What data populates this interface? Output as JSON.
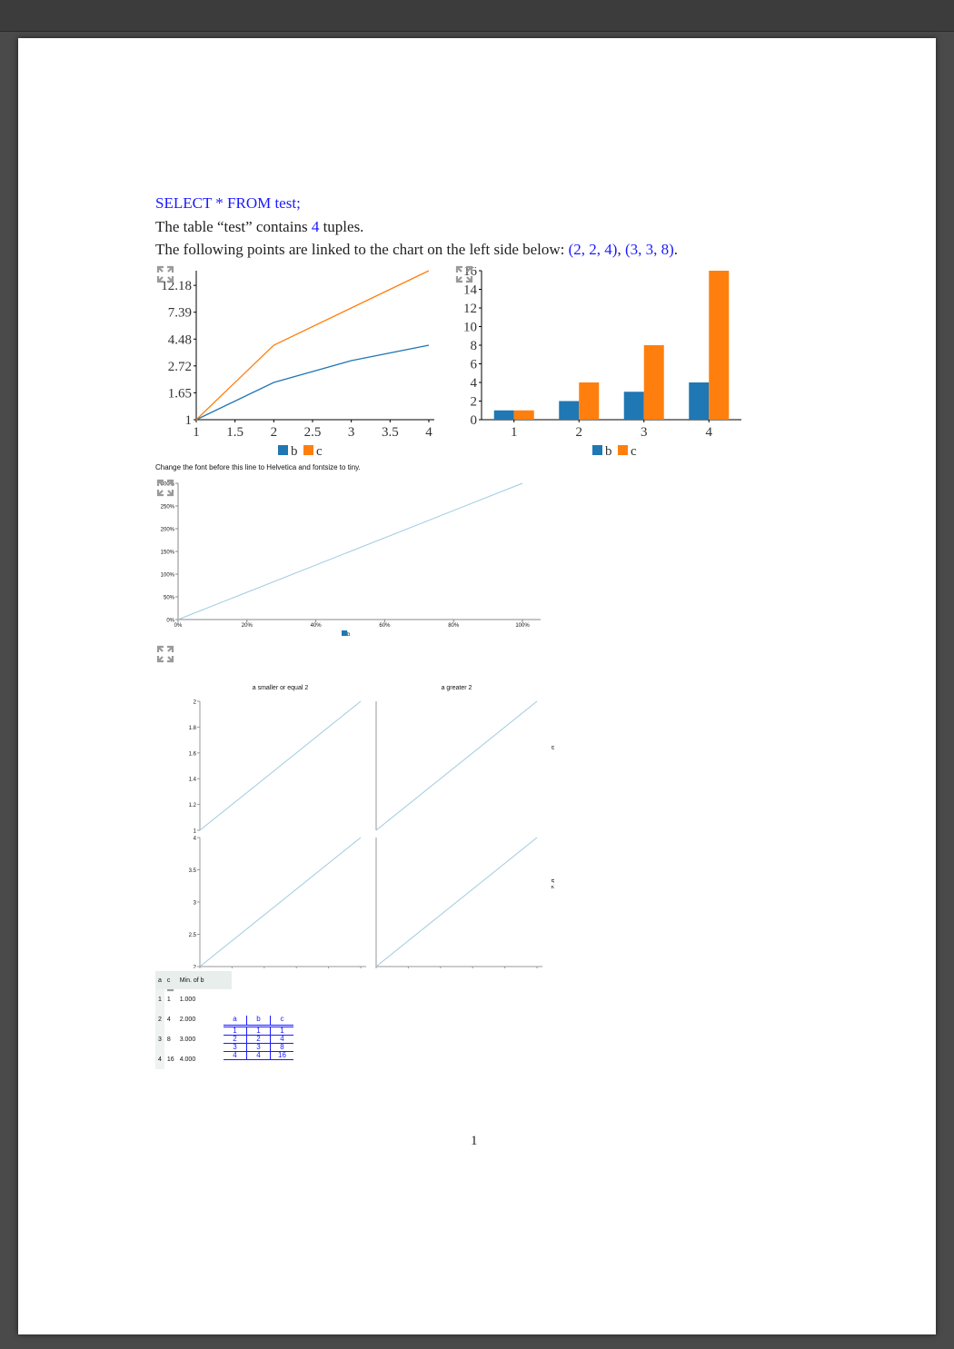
{
  "document": {
    "query": "SELECT * FROM test;",
    "table_sentence_prefix": "The table “test” contains ",
    "tuple_count": "4",
    "table_sentence_suffix": " tuples.",
    "points_sentence": "The following points are linked to the chart on the left side below: ",
    "points": [
      "(2, 2, 4)",
      "(3, 3, 8)"
    ],
    "points_sep": ", ",
    "points_end": ".",
    "font_note": "Change the font before this line to Helvetica and fontsize to tiny.",
    "page_number": "1"
  },
  "colors": {
    "blue_series": "#1f77b4",
    "orange_series": "#ff7f0e",
    "light_blue_series": "#9ecae1",
    "link_blue": "#1a1aff"
  },
  "icons": {
    "expand": "expand-arrows-icon"
  },
  "chart_data": [
    {
      "type": "line",
      "y_scale": "log",
      "x": [
        1,
        2,
        3,
        4
      ],
      "series": [
        {
          "name": "b",
          "values": [
            1,
            2,
            3,
            4
          ]
        },
        {
          "name": "c",
          "values": [
            1,
            4,
            8,
            16
          ]
        }
      ],
      "xticks": [
        "1",
        "1.5",
        "2",
        "2.5",
        "3",
        "3.5",
        "4"
      ],
      "yticks": [
        "1",
        "1.65",
        "2.72",
        "4.48",
        "7.39",
        "12.18"
      ],
      "legend": [
        "b",
        "c"
      ],
      "legend_position": "bottom"
    },
    {
      "type": "bar",
      "categories": [
        "1",
        "2",
        "3",
        "4"
      ],
      "series": [
        {
          "name": "b",
          "values": [
            1,
            2,
            3,
            4
          ]
        },
        {
          "name": "c",
          "values": [
            1,
            4,
            8,
            16
          ]
        }
      ],
      "yticks": [
        "0",
        "2",
        "4",
        "6",
        "8",
        "10",
        "12",
        "14",
        "16"
      ],
      "ylim": [
        0,
        16
      ],
      "legend": [
        "b",
        "c"
      ],
      "legend_position": "bottom"
    },
    {
      "type": "line",
      "x": [
        0,
        1
      ],
      "series": [
        {
          "name": "b",
          "values": [
            0,
            3
          ]
        }
      ],
      "xticks": [
        "0%",
        "20%",
        "40%",
        "60%",
        "80%",
        "100%"
      ],
      "yticks": [
        "0%",
        "50%",
        "100%",
        "150%",
        "200%",
        "250%",
        "300%"
      ],
      "legend": [
        "b"
      ],
      "legend_position": "bottom"
    },
    {
      "type": "line",
      "facets": {
        "columns": [
          "a smaller or equal 2",
          "a greater 2"
        ],
        "rows": [
          "b",
          "b^2"
        ]
      },
      "panels": [
        {
          "row": "b",
          "column": "a smaller or equal 2",
          "x": [
            1,
            2
          ],
          "y": [
            1,
            2
          ]
        },
        {
          "row": "b",
          "column": "a greater 2",
          "x": [
            3,
            4
          ],
          "y": [
            3,
            4
          ]
        },
        {
          "row": "b^2",
          "column": "a smaller or equal 2",
          "x": [
            1,
            2
          ],
          "y": [
            2,
            4
          ]
        },
        {
          "row": "b^2",
          "column": "a greater 2",
          "x": [
            3,
            4
          ],
          "y": [
            3,
            4
          ]
        }
      ],
      "row1_yticks": [
        "1",
        "1.2",
        "1.4",
        "1.6",
        "1.8",
        "2"
      ],
      "row2_yticks": [
        "2",
        "2.5",
        "3",
        "3.5",
        "4"
      ],
      "xticks_left": [
        "1",
        "1.2",
        "1.4",
        "1.6",
        "1.8",
        "2"
      ],
      "xticks_right": [
        "3",
        "3.2",
        "3.4",
        "3.6",
        "3.8",
        "4"
      ],
      "legend": [
        "b",
        "b^2"
      ],
      "legend_position": "bottom"
    }
  ],
  "summary_table": {
    "headers": [
      "a",
      "c",
      "Min. of b"
    ],
    "rows": [
      [
        "1",
        "1",
        "1.000"
      ],
      [
        "2",
        "4",
        "2.000"
      ],
      [
        "3",
        "8",
        "3.000"
      ],
      [
        "4",
        "16",
        "4.000"
      ]
    ]
  },
  "mini_table": {
    "headers": [
      "a",
      "b",
      "c"
    ],
    "rows": [
      [
        "1",
        "1",
        "1"
      ],
      [
        "2",
        "2",
        "4"
      ],
      [
        "3",
        "3",
        "8"
      ],
      [
        "4",
        "4",
        "16"
      ]
    ]
  }
}
